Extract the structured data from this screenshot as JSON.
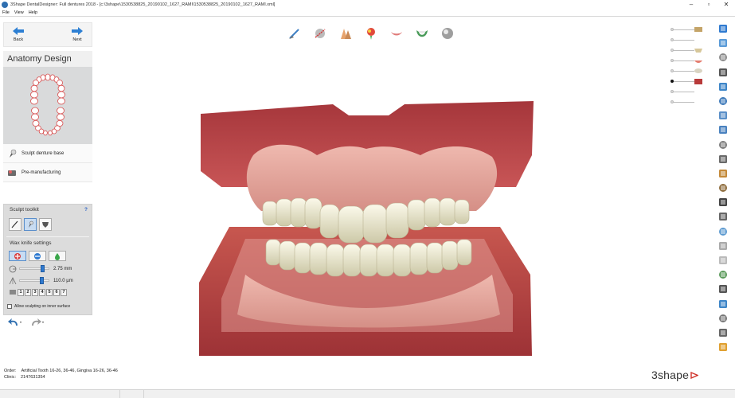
{
  "window": {
    "title": "3Shape DentalDesigner: Full dentures 2018 - [c:\\3shape\\1530538825_20190102_1627_RAMI\\1530538825_20190102_1627_RAMI.xml]"
  },
  "menu": [
    "File",
    "View",
    "Help"
  ],
  "nav": {
    "back_label": "Back",
    "next_label": "Next"
  },
  "step_title": "Anatomy Design",
  "sub_steps": [
    {
      "label": "Sculpt denture base",
      "icon": "sculpt-knife-icon"
    },
    {
      "label": "Pre-manufacturing",
      "icon": "premanufacturing-icon"
    }
  ],
  "sculpt_toolkit": {
    "header": "Sculpt toolkit",
    "help": "?",
    "tools": [
      "knife-tool-icon",
      "wax-knife-tool-icon",
      "smooth-tool-icon"
    ]
  },
  "wax_knife": {
    "header": "Wax knife settings",
    "modes": [
      "add-material-icon",
      "remove-material-icon",
      "smooth-material-icon"
    ],
    "radius": {
      "value": "2.75 mm",
      "level": 0.78
    },
    "strength": {
      "value": "110.0 µm",
      "level": 0.75
    },
    "presets": [
      "1",
      "2",
      "3",
      "4",
      "5",
      "6",
      "7"
    ],
    "allow_inner_label": "Allow sculpting on inner surface"
  },
  "top_tools": [
    "margin-tool-icon",
    "cut-tool-icon",
    "teeth-setup-icon",
    "color-tool-icon",
    "gingiva-icon",
    "denture-base-icon",
    "sphere-icon"
  ],
  "visibility_rows": [
    {
      "name": "maxilla-model",
      "on": false
    },
    {
      "name": "articulator",
      "on": false
    },
    {
      "name": "upper-teeth",
      "on": false
    },
    {
      "name": "upper-gingiva",
      "on": false
    },
    {
      "name": "lower-model",
      "on": false
    },
    {
      "name": "gingiva-red",
      "on": true
    },
    {
      "name": "antagonist",
      "on": false
    },
    {
      "name": "bite-guard",
      "on": false
    }
  ],
  "right_tools": [
    "close-view-icon",
    "fullscreen-icon",
    "ball-view-icon",
    "hat-icon",
    "front-view-icon",
    "back-view-icon",
    "left-view-icon",
    "right-view-icon",
    "wax-icon",
    "sculpt-icon",
    "measure-icon",
    "occlusion-icon",
    "ruler-icon",
    "clip-icon",
    "model-icon",
    "dimension-icon",
    "screenshot-icon",
    "teeth-view-icon",
    "lower-jaw-icon",
    "checkbox-view-icon",
    "settings-icon",
    "upper-jaw-icon",
    "color-wheel-icon"
  ],
  "order": {
    "order_label": "Order:",
    "order_value": "Artificial Tooth 16-26, 36-46, Gingiva 16-26, 36-46",
    "clinic_label": "Clinic:",
    "clinic_value": "2147631354"
  },
  "logo": "3shape",
  "colors": {
    "accent": "#2f7ad0",
    "model_red": "#b5464a",
    "gingiva_pink": "#e5a79f",
    "teeth": "#e9e6cf"
  }
}
